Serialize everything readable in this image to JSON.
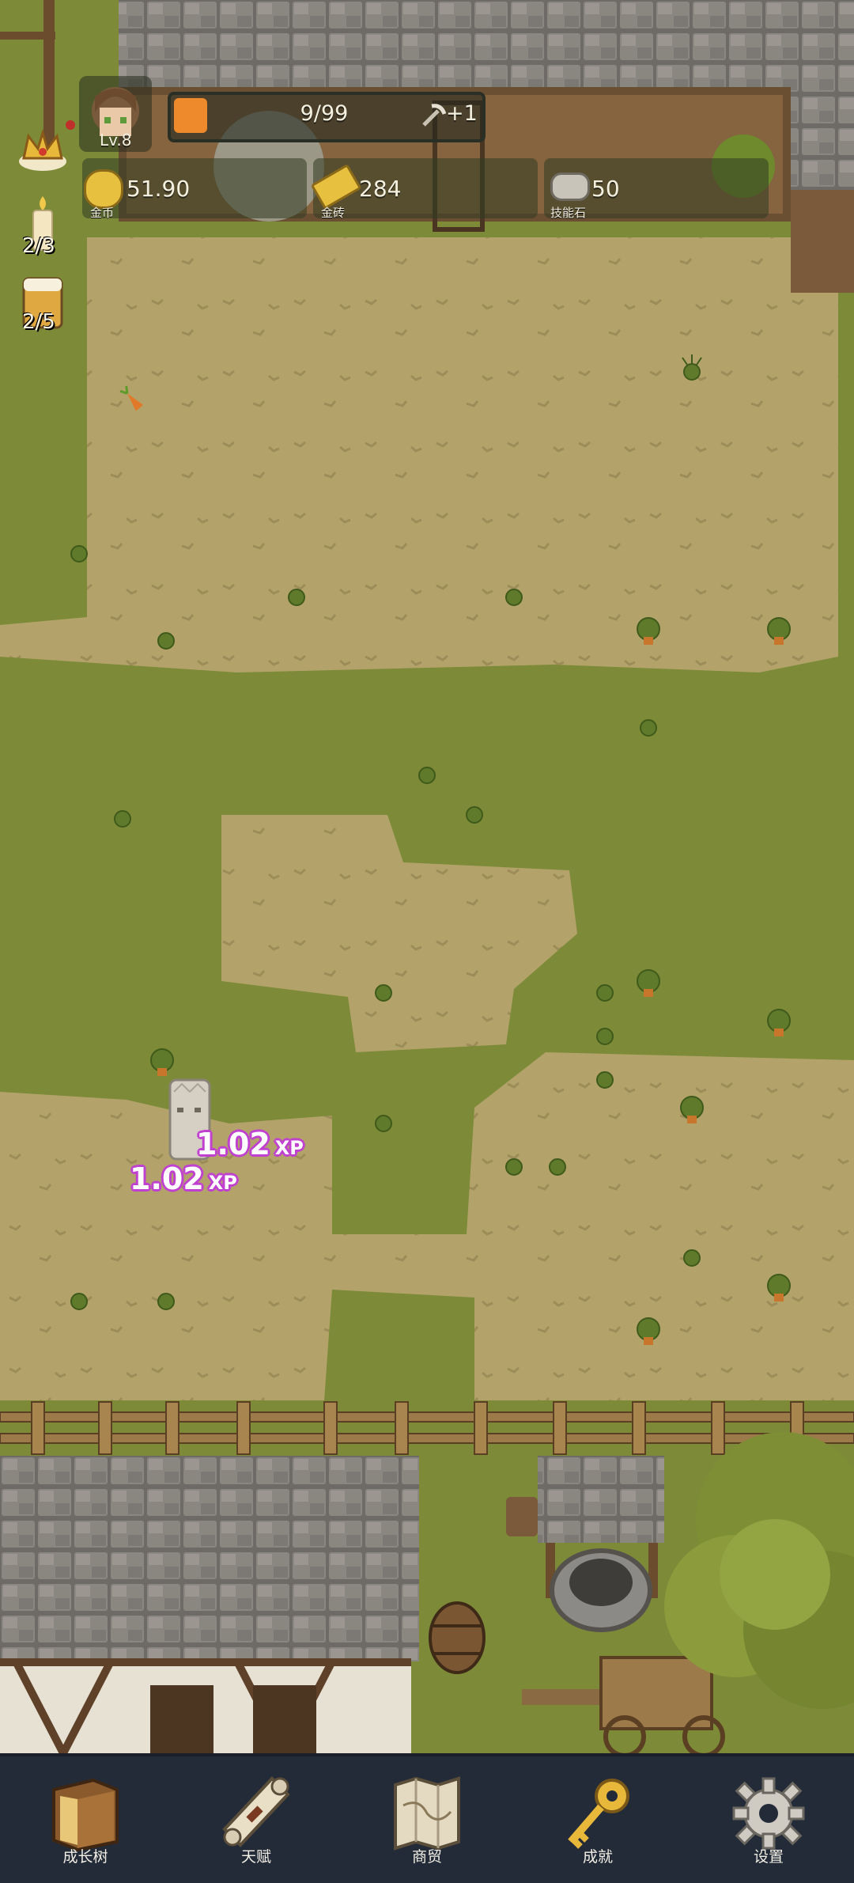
{
  "hud": {
    "level": "Lv.8",
    "progress": {
      "text": "9/99",
      "current": 9,
      "max": 99,
      "bonus": "+1"
    },
    "resources": [
      {
        "key": "coin",
        "icon": "gold-coin-icon",
        "value": "51.90",
        "label": "金币"
      },
      {
        "key": "brick",
        "icon": "gold-bar-icon",
        "value": "284",
        "label": "金砖"
      },
      {
        "key": "stone",
        "icon": "skill-stone-icon",
        "value": "50",
        "label": "技能石"
      }
    ],
    "counters": [
      {
        "icon": "crown-icon",
        "value": ""
      },
      {
        "icon": "candle-icon",
        "value": "2/3"
      },
      {
        "icon": "ale-mug-icon",
        "value": "2/5"
      }
    ]
  },
  "floaters": [
    {
      "value": "1.02",
      "unit": "XP"
    },
    {
      "value": "1.02",
      "unit": "XP"
    }
  ],
  "nav": [
    {
      "label": "成长树",
      "icon": "book-icon"
    },
    {
      "label": "天赋",
      "icon": "scroll-icon"
    },
    {
      "label": "商贸",
      "icon": "map-icon"
    },
    {
      "label": "成就",
      "icon": "key-icon"
    },
    {
      "label": "设置",
      "icon": "gear-icon"
    }
  ],
  "colors": {
    "grass": "#7d8a38",
    "dirt": "#b2a26a",
    "navbar": "#242b38",
    "xp_text": "#c040d0",
    "bar_fill": "#ee8a2c"
  }
}
